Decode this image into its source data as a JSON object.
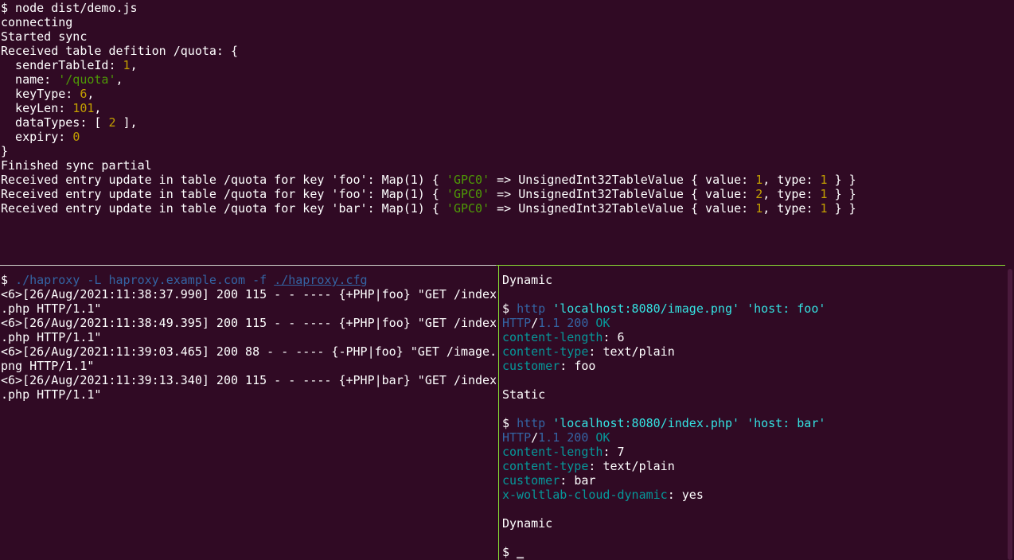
{
  "top_pane": {
    "prompt_line": "$ node dist/demo.js",
    "connecting": "connecting",
    "started_sync": "Started sync",
    "received_def": "Received table defition /quota: {",
    "fields": [
      {
        "key": "  senderTableId: ",
        "value": "1",
        "suffix": ","
      },
      {
        "key": "  name: ",
        "value": "'/quota'",
        "suffix": ","
      },
      {
        "key": "  keyType: ",
        "value": "6",
        "suffix": ","
      },
      {
        "key": "  keyLen: ",
        "value": "101",
        "suffix": ","
      },
      {
        "key": "  dataTypes: [ ",
        "value": "2",
        "suffix": " ],"
      },
      {
        "key": "  expiry: ",
        "value": "0",
        "suffix": ""
      }
    ],
    "close_brace": "}",
    "finished": "Finished sync partial",
    "updates": [
      {
        "prefix": "Received entry update in table /quota for key 'foo': Map(1) { ",
        "gpc": "'GPC0'",
        "mid": " => UnsignedInt32TableValue { value: ",
        "value": "1",
        "type_label": ", type: ",
        "type": "1",
        "end": " } }"
      },
      {
        "prefix": "Received entry update in table /quota for key 'foo': Map(1) { ",
        "gpc": "'GPC0'",
        "mid": " => UnsignedInt32TableValue { value: ",
        "value": "2",
        "type_label": ", type: ",
        "type": "1",
        "end": " } }"
      },
      {
        "prefix": "Received entry update in table /quota for key 'bar': Map(1) { ",
        "gpc": "'GPC0'",
        "mid": " => UnsignedInt32TableValue { value: ",
        "value": "1",
        "type_label": ", type: ",
        "type": "1",
        "end": " } }"
      }
    ]
  },
  "bottom_left": {
    "prompt": "$ ",
    "cmd": "./haproxy",
    "sp1": " ",
    "flag_l": "-L",
    "sp2": " ",
    "host": "haproxy.example.com",
    "sp3": " ",
    "flag_f": "-f",
    "sp4": " ",
    "cfg": "./haproxy.cfg",
    "log_lines": [
      "<6>[26/Aug/2021:11:38:37.990] 200 115 - - ---- {+PHP|foo} \"GET /index",
      ".php HTTP/1.1\"",
      "<6>[26/Aug/2021:11:38:49.395] 200 115 - - ---- {+PHP|foo} \"GET /index",
      ".php HTTP/1.1\"",
      "<6>[26/Aug/2021:11:39:03.465] 200 88 - - ---- {-PHP|foo} \"GET /image.",
      "png HTTP/1.1\"",
      "<6>[26/Aug/2021:11:39:13.340] 200 115 - - ---- {+PHP|bar} \"GET /index",
      ".php HTTP/1.1\""
    ]
  },
  "bottom_right": {
    "label_dynamic_1": "Dynamic",
    "req1": {
      "prompt": "$ ",
      "cmd": "http",
      "sp": " ",
      "url": "'localhost:8080/image.png'",
      "sp2": " ",
      "hdr": "'host: foo'"
    },
    "resp1": {
      "http": "HTTP",
      "slash": "/",
      "ver": "1.1",
      "sp": " ",
      "code": "200",
      "sp2": " ",
      "ok": "OK",
      "headers": [
        {
          "k": "content-length",
          "sep": ": ",
          "v": "6"
        },
        {
          "k": "content-type",
          "sep": ": ",
          "v": "text/plain"
        },
        {
          "k": "customer",
          "sep": ": ",
          "v": "foo"
        }
      ]
    },
    "label_static": "Static",
    "req2": {
      "prompt": "$ ",
      "cmd": "http",
      "sp": " ",
      "url": "'localhost:8080/index.php'",
      "sp2": " ",
      "hdr": "'host: bar'"
    },
    "resp2": {
      "http": "HTTP",
      "slash": "/",
      "ver": "1.1",
      "sp": " ",
      "code": "200",
      "sp2": " ",
      "ok": "OK",
      "headers": [
        {
          "k": "content-length",
          "sep": ": ",
          "v": "7"
        },
        {
          "k": "content-type",
          "sep": ": ",
          "v": "text/plain"
        },
        {
          "k": "customer",
          "sep": ": ",
          "v": "bar"
        },
        {
          "k": "x-woltlab-cloud-dynamic",
          "sep": ": ",
          "v": "yes"
        }
      ]
    },
    "label_dynamic_2": "Dynamic",
    "final_prompt": "$ ",
    "cursor": "_"
  },
  "colors": {
    "background": "#300a24",
    "foreground": "#ffffff",
    "number": "#c4a000",
    "string": "#4e9a06",
    "command": "#3465a4",
    "quoted": "#34e2e2",
    "header_key": "#06989a",
    "active_border": "#8ae234"
  }
}
